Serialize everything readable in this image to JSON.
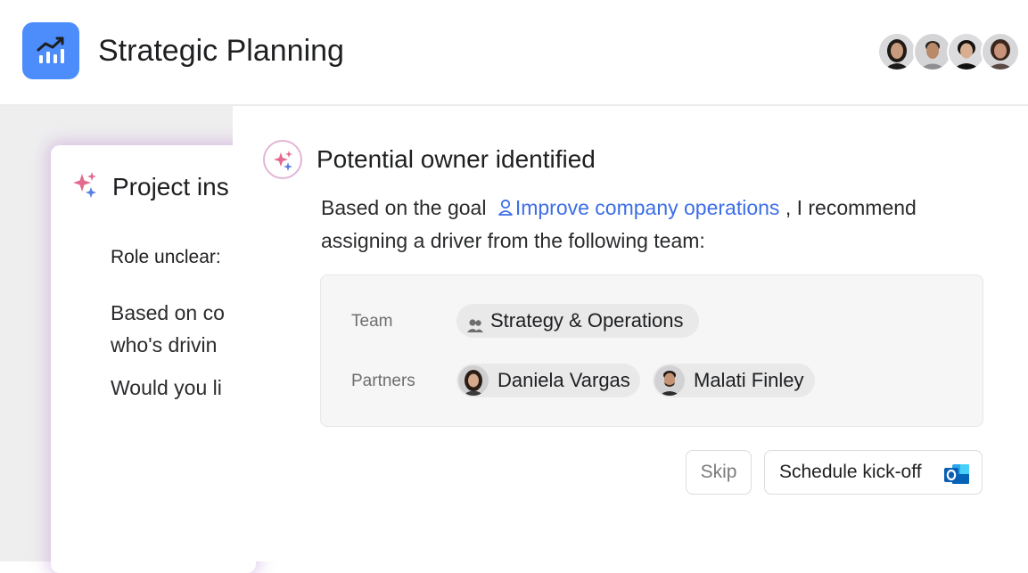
{
  "header": {
    "title": "Strategic Planning",
    "app_icon": "trending-chart-icon",
    "avatars": [
      "avatar-1",
      "avatar-2",
      "avatar-3",
      "avatar-4"
    ]
  },
  "background_card": {
    "title": "Project ins",
    "role_label": "Role unclear:",
    "paragraph_1_line_1": "Based on co",
    "paragraph_1_line_2": "who's drivin",
    "paragraph_2": "Would you li"
  },
  "panel": {
    "title": "Potential owner identified",
    "body_prefix": "Based on the goal",
    "goal_link": "Improve company operations",
    "body_suffix_1": ", I recommend",
    "body_line_2": "assigning a driver from the following team:",
    "team_label": "Team",
    "team_value": "Strategy & Operations",
    "partners_label": "Partners",
    "partners": [
      {
        "name": "Daniela Vargas"
      },
      {
        "name": "Malati Finley"
      }
    ]
  },
  "actions": {
    "skip_label": "Skip",
    "schedule_label": "Schedule kick-off"
  },
  "colors": {
    "app_icon_bg": "#4c8dfb",
    "link": "#3d6ee6",
    "sparkle_pink": "#e36b8f",
    "sparkle_blue": "#5b7fe0"
  }
}
